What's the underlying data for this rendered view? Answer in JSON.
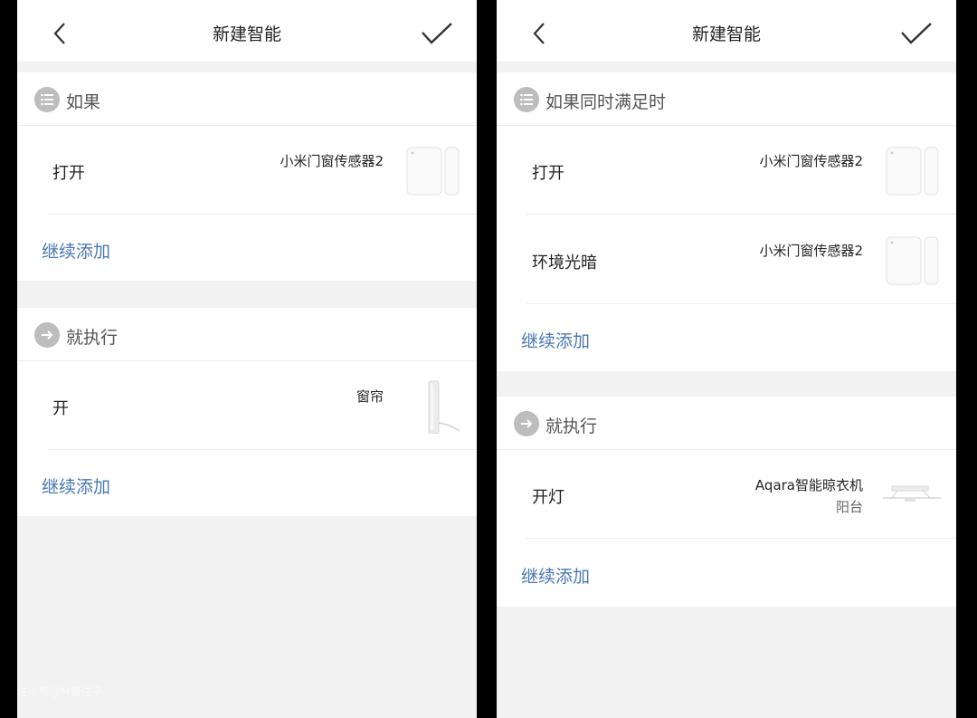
{
  "left": {
    "header": {
      "title": "新建智能"
    },
    "if_section": {
      "title": "如果",
      "rows": [
        {
          "label": "打开",
          "device": "小米门窗传感器2"
        }
      ],
      "add_label": "继续添加"
    },
    "then_section": {
      "title": "就执行",
      "rows": [
        {
          "label": "开",
          "device": "窗帘"
        }
      ],
      "add_label": "继续添加"
    }
  },
  "right": {
    "header": {
      "title": "新建智能"
    },
    "if_section": {
      "title": "如果同时满足时",
      "rows": [
        {
          "label": "打开",
          "device": "小米门窗传感器2"
        },
        {
          "label": "环境光暗",
          "device": "小米门窗传感器2"
        }
      ],
      "add_label": "继续添加"
    },
    "then_section": {
      "title": "就执行",
      "rows": [
        {
          "label": "开灯",
          "device": "Aqara智能晾衣机",
          "room": "阳台"
        }
      ],
      "add_label": "继续添加"
    }
  },
  "watermark": "住小帮@M慢住子",
  "colors": {
    "link": "#4a78b4",
    "section_icon": "#bdbdbd",
    "background": "#f2f2f2"
  },
  "icons": {
    "back": "chevron-left-icon",
    "confirm": "checkmark-icon",
    "if_section": "list-icon",
    "then_section": "arrow-right-circle-icon",
    "sensor": "door-window-sensor-image",
    "curtain": "curtain-motor-image",
    "airer": "clothes-airer-image"
  }
}
